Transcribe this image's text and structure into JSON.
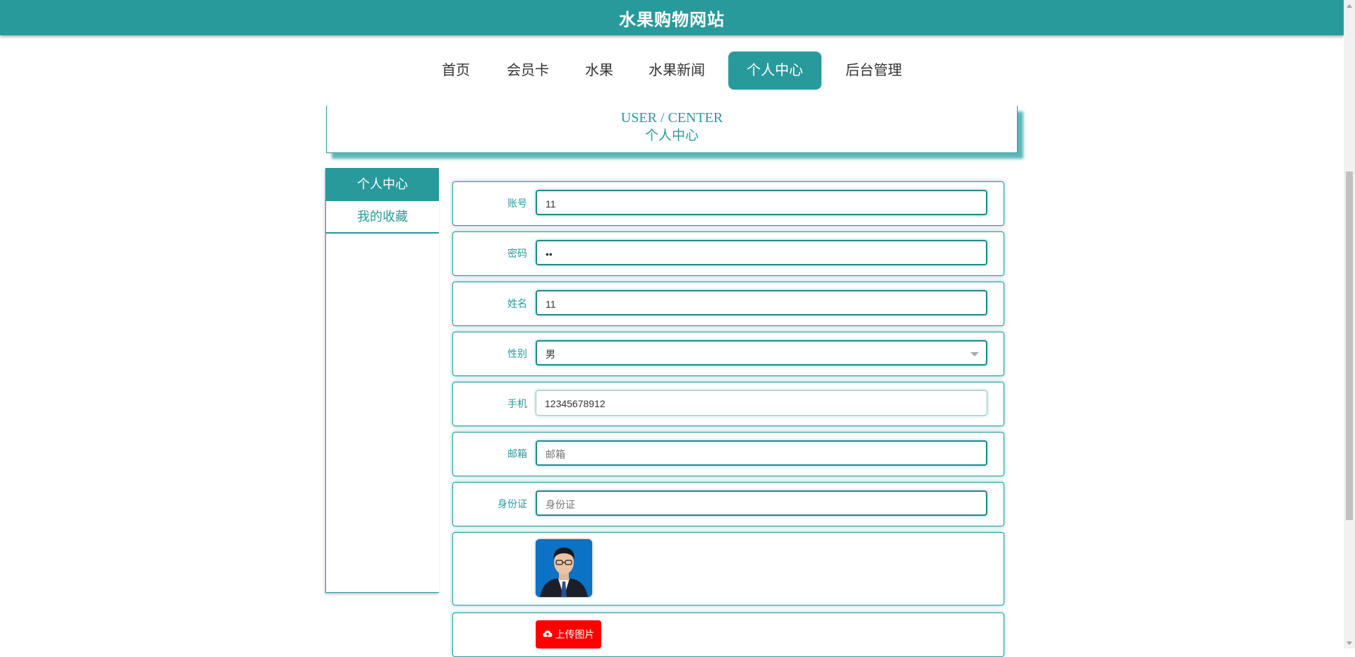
{
  "site": {
    "title": "水果购物网站"
  },
  "nav": {
    "items": [
      {
        "label": "首页"
      },
      {
        "label": "会员卡"
      },
      {
        "label": "水果"
      },
      {
        "label": "水果新闻"
      },
      {
        "label": "个人中心",
        "active": true
      },
      {
        "label": "后台管理"
      }
    ]
  },
  "banner": {
    "en": "USER / CENTER",
    "cn": "个人中心"
  },
  "sidebar": {
    "items": [
      {
        "label": "个人中心",
        "active": true
      },
      {
        "label": "我的收藏"
      }
    ]
  },
  "form": {
    "account": {
      "label": "账号",
      "value": "11"
    },
    "password": {
      "label": "密码",
      "value": "••"
    },
    "name": {
      "label": "姓名",
      "value": "11"
    },
    "gender": {
      "label": "性别",
      "value": "男"
    },
    "phone": {
      "label": "手机",
      "value": "12345678912"
    },
    "email": {
      "label": "邮箱",
      "value": "",
      "placeholder": "邮箱"
    },
    "idcard": {
      "label": "身份证",
      "value": "",
      "placeholder": "身份证"
    },
    "upload": {
      "label": "上传图片"
    }
  },
  "colors": {
    "accent": "#289a9c",
    "upload": "#ff0000"
  },
  "icons": {
    "upload": "cloud-upload-icon",
    "select": "chevron-down-icon"
  }
}
